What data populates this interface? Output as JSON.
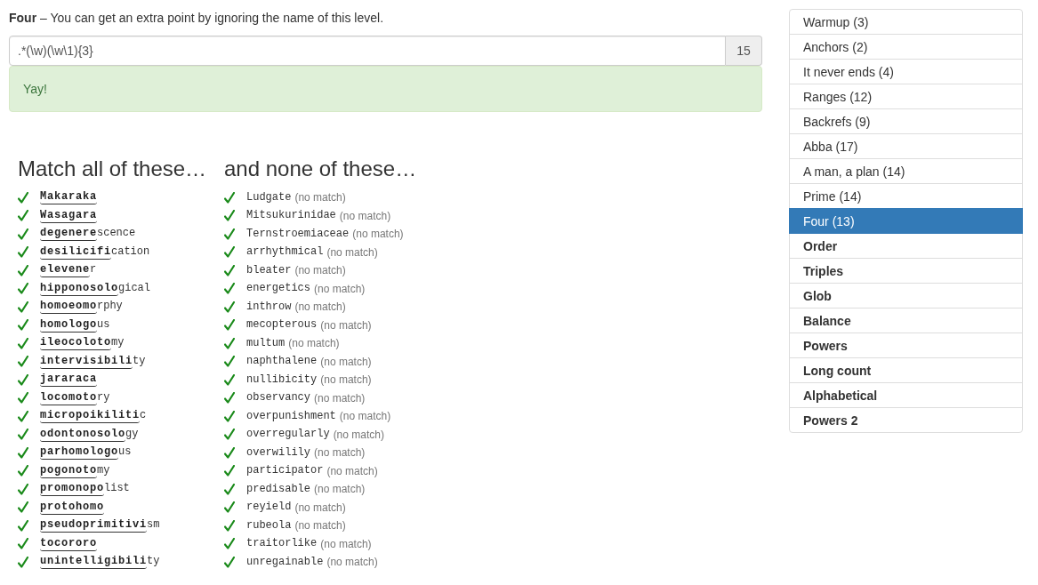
{
  "level": {
    "description": "**Four** – You can get an extra point by ignoring the name of this level."
  },
  "regex": {
    "value": ".*(\\w)(\\w\\1){3}",
    "length": "15"
  },
  "result": {
    "kind": "success",
    "message": "Yay!"
  },
  "match_list": {
    "heading": "Match all of these…",
    "items": [
      {
        "matched": "Makaraka",
        "passed": true
      },
      {
        "matched": "Wasagara",
        "passed": true
      },
      {
        "matched": "degenere",
        "rest": "scence",
        "passed": true
      },
      {
        "matched": "desilicifi",
        "rest": "cation",
        "passed": true
      },
      {
        "matched": "elevene",
        "rest": "r",
        "passed": true
      },
      {
        "matched": "hipponosolo",
        "rest": "gical",
        "passed": true
      },
      {
        "matched": "homoeomo",
        "rest": "rphy",
        "passed": true
      },
      {
        "matched": "homologo",
        "rest": "us",
        "passed": true
      },
      {
        "matched": "ileocoloto",
        "rest": "my",
        "passed": true
      },
      {
        "matched": "intervisibili",
        "rest": "ty",
        "passed": true
      },
      {
        "matched": "jararaca",
        "passed": true
      },
      {
        "matched": "locomoto",
        "rest": "ry",
        "passed": true
      },
      {
        "matched": "micropoikiliti",
        "rest": "c",
        "passed": true
      },
      {
        "matched": "odontonosolo",
        "rest": "gy",
        "passed": true
      },
      {
        "matched": "parhomologo",
        "rest": "us",
        "passed": true
      },
      {
        "matched": "pogonoto",
        "rest": "my",
        "passed": true
      },
      {
        "matched": "promonopo",
        "rest": "list",
        "passed": true
      },
      {
        "matched": "protohomo",
        "passed": true
      },
      {
        "matched": "pseudoprimitivi",
        "rest": "sm",
        "passed": true
      },
      {
        "matched": "tocororo",
        "passed": true
      },
      {
        "matched": "unintelligibili",
        "rest": "ty",
        "passed": true
      }
    ]
  },
  "nonmatch_list": {
    "heading": "and none of these…",
    "items": [
      {
        "word": "Ludgate",
        "note": "(no match)",
        "passed": true
      },
      {
        "word": "Mitsukurinidae",
        "note": "(no match)",
        "passed": true
      },
      {
        "word": "Ternstroemiaceae",
        "note": "(no match)",
        "passed": true
      },
      {
        "word": "arrhythmical",
        "note": "(no match)",
        "passed": true
      },
      {
        "word": "bleater",
        "note": "(no match)",
        "passed": true
      },
      {
        "word": "energetics",
        "note": "(no match)",
        "passed": true
      },
      {
        "word": "inthrow",
        "note": "(no match)",
        "passed": true
      },
      {
        "word": "mecopterous",
        "note": "(no match)",
        "passed": true
      },
      {
        "word": "multum",
        "note": "(no match)",
        "passed": true
      },
      {
        "word": "naphthalene",
        "note": "(no match)",
        "passed": true
      },
      {
        "word": "nullibicity",
        "note": "(no match)",
        "passed": true
      },
      {
        "word": "observancy",
        "note": "(no match)",
        "passed": true
      },
      {
        "word": "overpunishment",
        "note": "(no match)",
        "passed": true
      },
      {
        "word": "overregularly",
        "note": "(no match)",
        "passed": true
      },
      {
        "word": "overwilily",
        "note": "(no match)",
        "passed": true
      },
      {
        "word": "participator",
        "note": "(no match)",
        "passed": true
      },
      {
        "word": "predisable",
        "note": "(no match)",
        "passed": true
      },
      {
        "word": "reyield",
        "note": "(no match)",
        "passed": true
      },
      {
        "word": "rubeola",
        "note": "(no match)",
        "passed": true
      },
      {
        "word": "traitorlike",
        "note": "(no match)",
        "passed": true
      },
      {
        "word": "unregainable",
        "note": "(no match)",
        "passed": true
      }
    ]
  },
  "levels": [
    {
      "label": "Warmup (3)",
      "solved": true,
      "selected": false
    },
    {
      "label": "Anchors (2)",
      "solved": true,
      "selected": false
    },
    {
      "label": "It never ends (4)",
      "solved": true,
      "selected": false
    },
    {
      "label": "Ranges (12)",
      "solved": true,
      "selected": false
    },
    {
      "label": "Backrefs (9)",
      "solved": true,
      "selected": false
    },
    {
      "label": "Abba (17)",
      "solved": true,
      "selected": false
    },
    {
      "label": "A man, a plan (14)",
      "solved": true,
      "selected": false
    },
    {
      "label": "Prime (14)",
      "solved": true,
      "selected": false
    },
    {
      "label": "Four (13)",
      "solved": true,
      "selected": true
    },
    {
      "label": "Order",
      "solved": false,
      "selected": false
    },
    {
      "label": "Triples",
      "solved": false,
      "selected": false
    },
    {
      "label": "Glob",
      "solved": false,
      "selected": false
    },
    {
      "label": "Balance",
      "solved": false,
      "selected": false
    },
    {
      "label": "Powers",
      "solved": false,
      "selected": false
    },
    {
      "label": "Long count",
      "solved": false,
      "selected": false
    },
    {
      "label": "Alphabetical",
      "solved": false,
      "selected": false
    },
    {
      "label": "Powers 2",
      "solved": false,
      "selected": false
    }
  ]
}
